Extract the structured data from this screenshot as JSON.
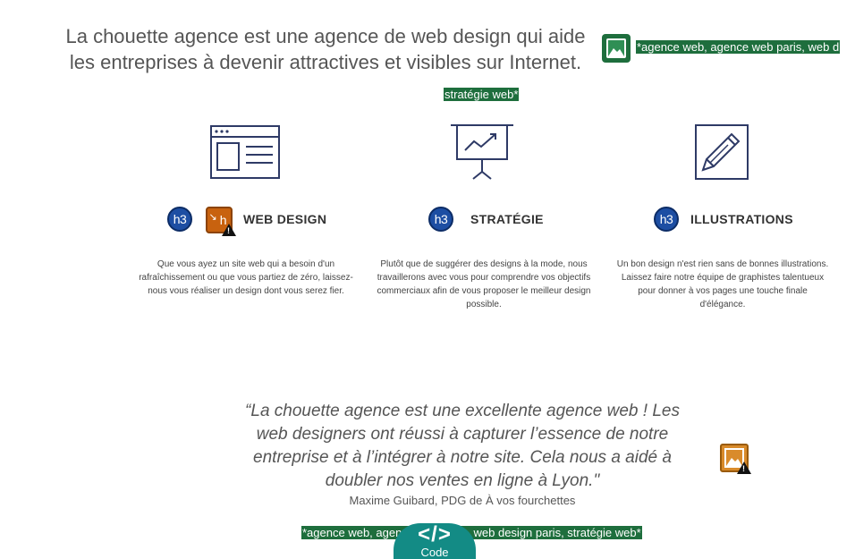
{
  "intro": {
    "line1": "La chouette agence est une agence de web design qui aide",
    "line2": "les entreprises à devenir attractives et visibles sur Internet."
  },
  "alt_chip_top": "*agence web, agence web paris, web d",
  "alt_chip_top_wrap": "stratégie web*",
  "features": [
    {
      "heading_badge": "h3",
      "title": "WEB DESIGN",
      "text": "Que vous ayez un site web qui a besoin d'un rafraîchissement ou que vous partiez de zéro, laissez-nous vous réaliser un design dont vous serez fier.",
      "icon": "browser-window-icon"
    },
    {
      "heading_badge": "h3",
      "title": "STRATÉGIE",
      "text": "Plutôt que de suggérer des designs à la mode, nous travaillerons avec vous pour comprendre vos objectifs commerciaux afin de vous proposer le meilleur design possible.",
      "icon": "presentation-chart-icon"
    },
    {
      "heading_badge": "h3",
      "title": "ILLUSTRATIONS",
      "text": "Un bon design n'est rien sans de bonnes illustrations. Laissez faire notre équipe de graphistes talentueux pour donner à vos pages une touche finale d'élégance.",
      "icon": "pencil-frame-icon"
    }
  ],
  "warning_badge_letter": "h",
  "testimonial": {
    "quote": "“La chouette agence est une excellente agence web ! Les web designers ont réussi à capturer l’essence de notre entreprise et à l’intégrer à notre site. Cela nous a aidé à doubler nos ventes en ligne à Lyon.\"",
    "author": "Maxime Guibard, PDG de À vos fourchettes"
  },
  "alt_chip_bottom": "*agence web, agence web paris, web design paris, stratégie web*",
  "code_tab": {
    "glyph": "</>",
    "label": "Code"
  },
  "colors": {
    "chip_green": "#1e6e3d",
    "h3_blue": "#1d4ea3",
    "warning_orange": "#c8620f",
    "code_teal": "#138b85",
    "icon_navy": "#2e3a66"
  }
}
